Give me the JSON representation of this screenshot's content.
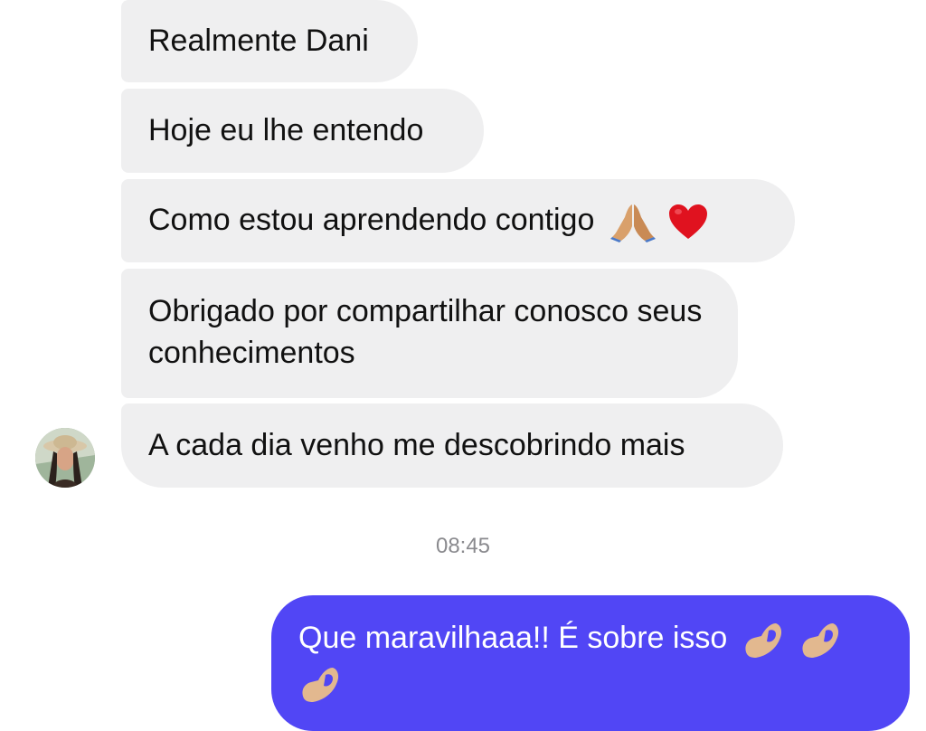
{
  "conversation": {
    "incoming_messages": [
      {
        "text": "Realmente Dani"
      },
      {
        "text": "Hoje eu lhe entendo"
      },
      {
        "text": "Como estou aprendendo contigo",
        "emojis": [
          "folded-hands-emoji",
          "red-heart-emoji"
        ]
      },
      {
        "text": "Obrigado por compartilhar conosco seus conhecimentos"
      },
      {
        "text": "A cada dia venho me descobrindo mais"
      }
    ],
    "timestamp": "08:45",
    "outgoing_message": {
      "text": "Que maravilhaaa!! É sobre isso",
      "emojis": [
        "pinching-hand-emoji",
        "pinching-hand-emoji",
        "pinching-hand-emoji"
      ]
    }
  },
  "colors": {
    "incoming_bubble": "#efeff0",
    "outgoing_bubble": "#5146f5",
    "timestamp_text": "#8a8a8e"
  }
}
